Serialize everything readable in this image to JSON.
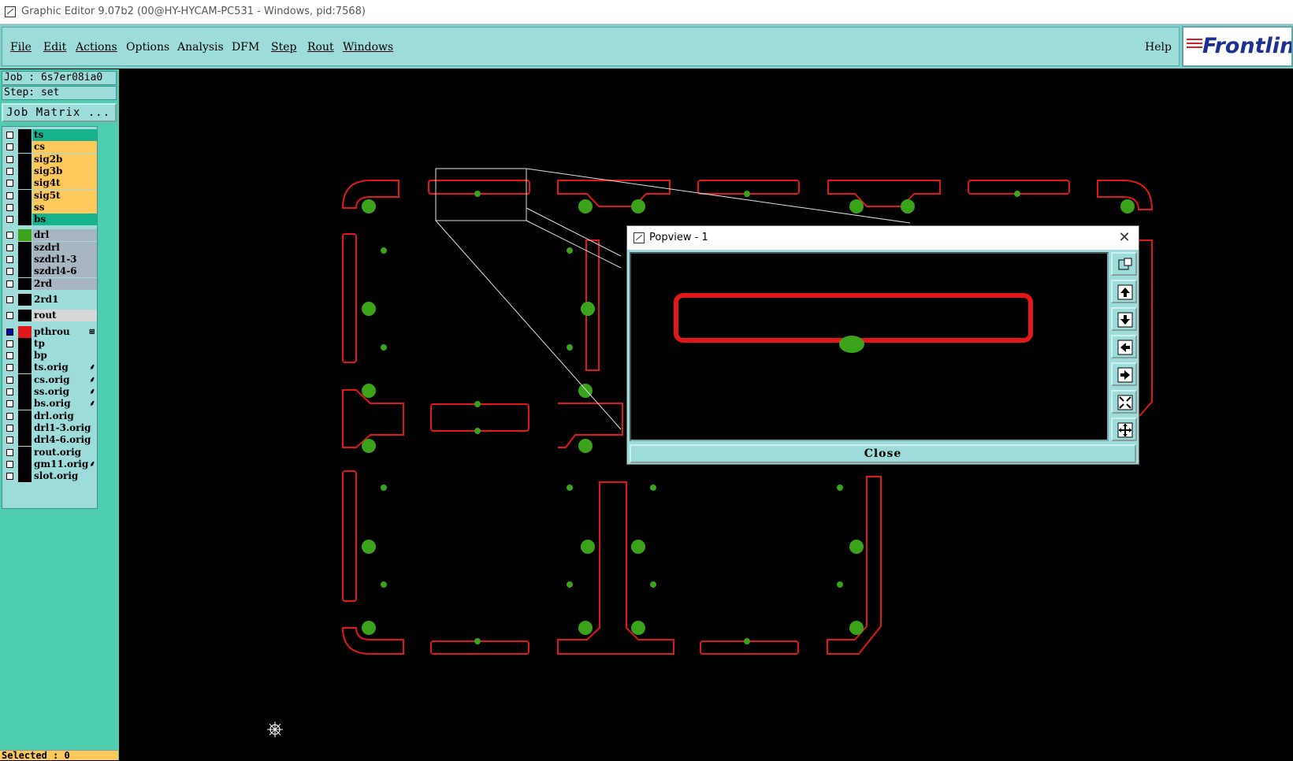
{
  "window": {
    "title": "Graphic Editor 9.07b2 (00@HY-HYCAM-PC531 - Windows, pid:7568)"
  },
  "menu": {
    "items": [
      "File",
      "Edit",
      "Actions",
      "Options",
      "Analysis",
      "DFM",
      "Step",
      "Rout",
      "Windows"
    ],
    "help": "Help",
    "logo": "Frontline"
  },
  "side": {
    "job": "Job : 6s7er08ia0",
    "step": "Step: set",
    "job_matrix": "Job Matrix ...",
    "selected": "Selected : 0"
  },
  "layers": [
    {
      "name": "ts",
      "color": "#17b38f",
      "swatch": "#000"
    },
    {
      "name": "cs",
      "color": "#ffc85a",
      "swatch": "#000"
    },
    {
      "name": "sig2b",
      "color": "#ffc85a",
      "swatch": "#000"
    },
    {
      "name": "sig3b",
      "color": "#ffc85a",
      "swatch": "#000"
    },
    {
      "name": "sig4t",
      "color": "#ffc85a",
      "swatch": "#000"
    },
    {
      "name": "sig5t",
      "color": "#ffc85a",
      "swatch": "#000"
    },
    {
      "name": "ss",
      "color": "#ffc85a",
      "swatch": "#000"
    },
    {
      "name": "bs",
      "color": "#17b38f",
      "swatch": "#000"
    },
    {
      "name": "drl",
      "color": "#a7b6c2",
      "swatch": "#3aa31a"
    },
    {
      "name": "szdrl",
      "color": "#a7b6c2",
      "swatch": "#000"
    },
    {
      "name": "szdrl1-3",
      "color": "#a7b6c2",
      "swatch": "#000"
    },
    {
      "name": "szdrl4-6",
      "color": "#a7b6c2",
      "swatch": "#000"
    },
    {
      "name": "2rd",
      "color": "#a7b6c2",
      "swatch": "#000"
    },
    {
      "name": "2rd1",
      "color": "#9edcdc",
      "swatch": "#000"
    },
    {
      "name": "rout",
      "color": "#d8d8d8",
      "swatch": "#000"
    },
    {
      "name": "pthrou",
      "color": "#9edcdc",
      "swatch": "#e01818",
      "mark": "⊞"
    },
    {
      "name": "tp",
      "color": "#9edcdc",
      "swatch": "#000"
    },
    {
      "name": "bp",
      "color": "#9edcdc",
      "swatch": "#000"
    },
    {
      "name": "ts.orig",
      "color": "#9edcdc",
      "swatch": "#000",
      "mark": "⸙"
    },
    {
      "name": "cs.orig",
      "color": "#9edcdc",
      "swatch": "#000",
      "mark": "⸙"
    },
    {
      "name": "ss.orig",
      "color": "#9edcdc",
      "swatch": "#000",
      "mark": "⸙"
    },
    {
      "name": "bs.orig",
      "color": "#9edcdc",
      "swatch": "#000",
      "mark": "⸙"
    },
    {
      "name": "drl.orig",
      "color": "#9edcdc",
      "swatch": "#000"
    },
    {
      "name": "drl1-3.orig",
      "color": "#9edcdc",
      "swatch": "#000"
    },
    {
      "name": "drl4-6.orig",
      "color": "#9edcdc",
      "swatch": "#000"
    },
    {
      "name": "rout.orig",
      "color": "#9edcdc",
      "swatch": "#000"
    },
    {
      "name": "gm11.orig",
      "color": "#9edcdc",
      "swatch": "#000",
      "mark": "⸙"
    },
    {
      "name": "slot.orig",
      "color": "#9edcdc",
      "swatch": "#000"
    }
  ],
  "popview": {
    "title": "Popview - 1",
    "close_label": "Close",
    "tools": [
      "zoom-box-icon",
      "pan-up-icon",
      "pan-down-icon",
      "pan-left-icon",
      "pan-right-icon",
      "zoom-in-icon",
      "zoom-out-icon"
    ]
  },
  "colors": {
    "outline": "#e01818",
    "pad": "#3aa31a",
    "selection": "#e0e0e0"
  }
}
